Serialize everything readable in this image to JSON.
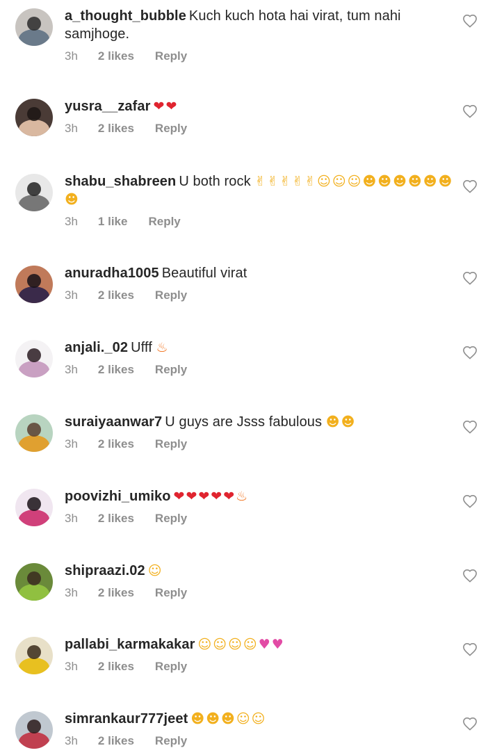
{
  "comments": [
    {
      "username": "a_thought_bubble",
      "text": "Kuch kuch hota hai virat, tum nahi samjhoge.",
      "emoji": [],
      "time": "3h",
      "likes": "2 likes",
      "reply": "Reply",
      "avatar_colors": [
        "#c8c4c0",
        "#6a7a8a",
        "#2b2b2b"
      ]
    },
    {
      "username": "yusra__zafar",
      "text": "",
      "emoji": [
        "heart-red",
        "heart-red"
      ],
      "time": "3h",
      "likes": "2 likes",
      "reply": "Reply",
      "avatar_colors": [
        "#4a3b36",
        "#d9b8a0",
        "#1c1614"
      ]
    },
    {
      "username": "shabu_shabreen",
      "text": "U both rock",
      "emoji": [
        "rock-hand",
        "rock-hand",
        "rock-hand",
        "rock-hand",
        "rock-hand",
        "heart-eyes",
        "heart-eyes",
        "heart-eyes",
        "kiss-face",
        "kiss-face",
        "kiss-face",
        "kiss-face",
        "kiss-face",
        "kiss-face",
        "kiss-face"
      ],
      "time": "3h",
      "likes": "1 like",
      "reply": "Reply",
      "avatar_colors": [
        "#e8e8e8",
        "#777777",
        "#222222"
      ]
    },
    {
      "username": "anuradha1005",
      "text": "Beautiful virat",
      "emoji": [],
      "time": "3h",
      "likes": "2 likes",
      "reply": "Reply",
      "avatar_colors": [
        "#c07a5a",
        "#3a2a4a",
        "#161018"
      ]
    },
    {
      "username": "anjali._02",
      "text": "Ufff",
      "emoji": [
        "fire"
      ],
      "time": "3h",
      "likes": "2 likes",
      "reply": "Reply",
      "avatar_colors": [
        "#f4f2f4",
        "#c9a0c2",
        "#2a1c22"
      ]
    },
    {
      "username": "suraiyaanwar7",
      "text": "U guys are Jsss fabulous",
      "emoji": [
        "kiss-face",
        "kiss-face"
      ],
      "time": "3h",
      "likes": "2 likes",
      "reply": "Reply",
      "avatar_colors": [
        "#b8d4c0",
        "#e0a030",
        "#5a4030"
      ]
    },
    {
      "username": "poovizhi_umiko",
      "text": "",
      "emoji": [
        "heart-red",
        "heart-red",
        "heart-red",
        "heart-red",
        "heart-red",
        "fire"
      ],
      "time": "3h",
      "likes": "2 likes",
      "reply": "Reply",
      "avatar_colors": [
        "#f0e6f0",
        "#d0407a",
        "#1a1218"
      ]
    },
    {
      "username": "shipraazi.02",
      "text": "",
      "emoji": [
        "heart-eyes"
      ],
      "time": "3h",
      "likes": "2 likes",
      "reply": "Reply",
      "avatar_colors": [
        "#6a8a3a",
        "#90c040",
        "#3a2a20"
      ]
    },
    {
      "username": "pallabi_karmakakar",
      "text": "",
      "emoji": [
        "hug-face",
        "hug-face",
        "hug-face",
        "hug-face",
        "two-hearts",
        "two-hearts"
      ],
      "time": "3h",
      "likes": "2 likes",
      "reply": "Reply",
      "avatar_colors": [
        "#e8e0c8",
        "#e8c020",
        "#3a2a1a"
      ]
    },
    {
      "username": "simrankaur777jeet",
      "text": "",
      "emoji": [
        "kiss-face",
        "kiss-face",
        "kiss-face",
        "heart-eyes",
        "heart-eyes"
      ],
      "time": "3h",
      "likes": "2 likes",
      "reply": "Reply",
      "avatar_colors": [
        "#c0c8d0",
        "#c04050",
        "#2a1a1a"
      ]
    }
  ],
  "colors": {
    "username": "#262626",
    "text": "#262626",
    "meta": "#8e8e8e",
    "heart_outline": "#8e8e8e"
  }
}
